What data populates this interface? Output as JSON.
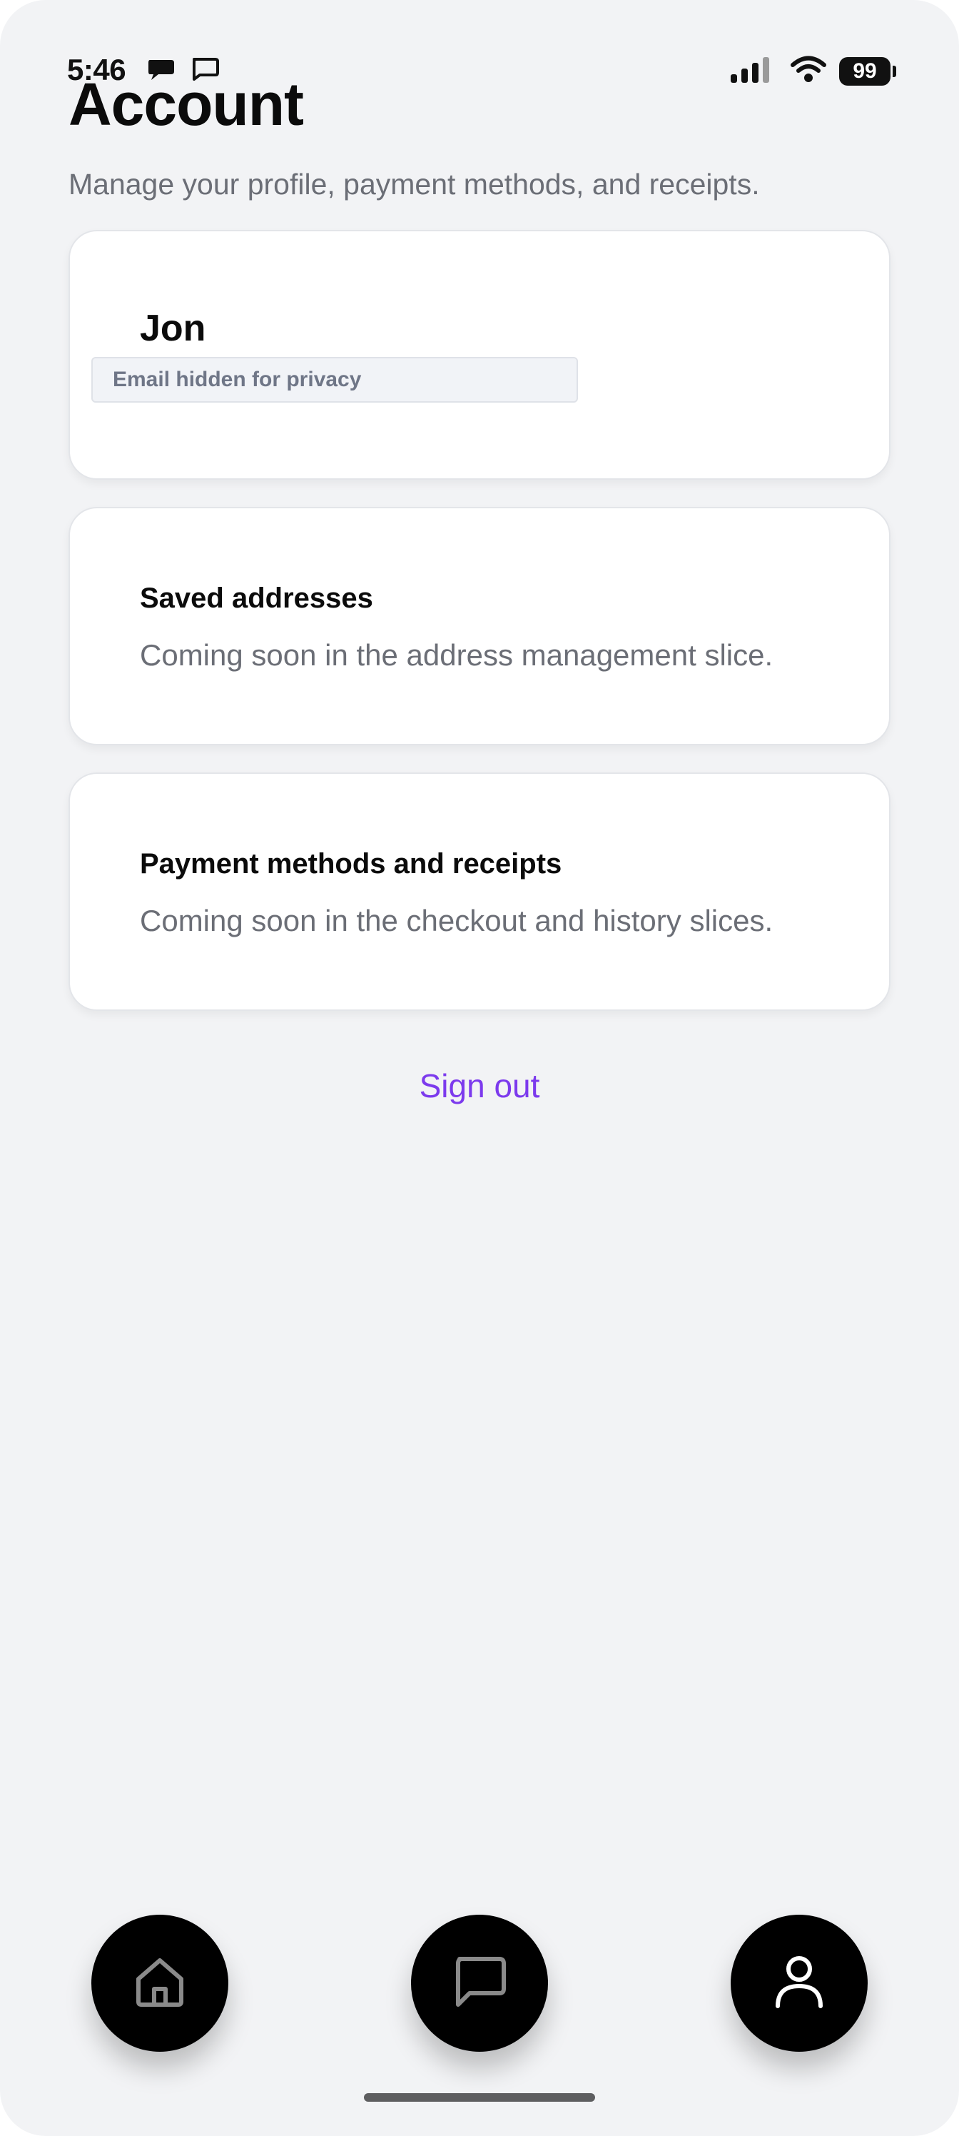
{
  "status_bar": {
    "time": "5:46",
    "battery_level": "99",
    "icons": [
      "chat-bubble-icon",
      "message-icon",
      "signal-icon",
      "wifi-icon",
      "battery-icon"
    ]
  },
  "header": {
    "title": "Account",
    "subtitle": "Manage your profile, payment methods, and receipts."
  },
  "profile_card": {
    "name": "Jon",
    "email_notice": "Email hidden for privacy"
  },
  "addresses_card": {
    "title": "Saved addresses",
    "description": "Coming soon in the address management slice."
  },
  "payments_card": {
    "title": "Payment methods and receipts",
    "description": "Coming soon in the checkout and history slices."
  },
  "actions": {
    "sign_out": "Sign out"
  },
  "bottom_nav": {
    "items": [
      {
        "name": "home",
        "icon": "home-icon",
        "active": false
      },
      {
        "name": "chats",
        "icon": "chat-icon",
        "active": false
      },
      {
        "name": "account",
        "icon": "user-icon",
        "active": true
      }
    ]
  },
  "colors": {
    "accent": "#7c3aed",
    "background": "#f2f3f5",
    "card": "#ffffff",
    "muted_text": "#6b6e76"
  }
}
